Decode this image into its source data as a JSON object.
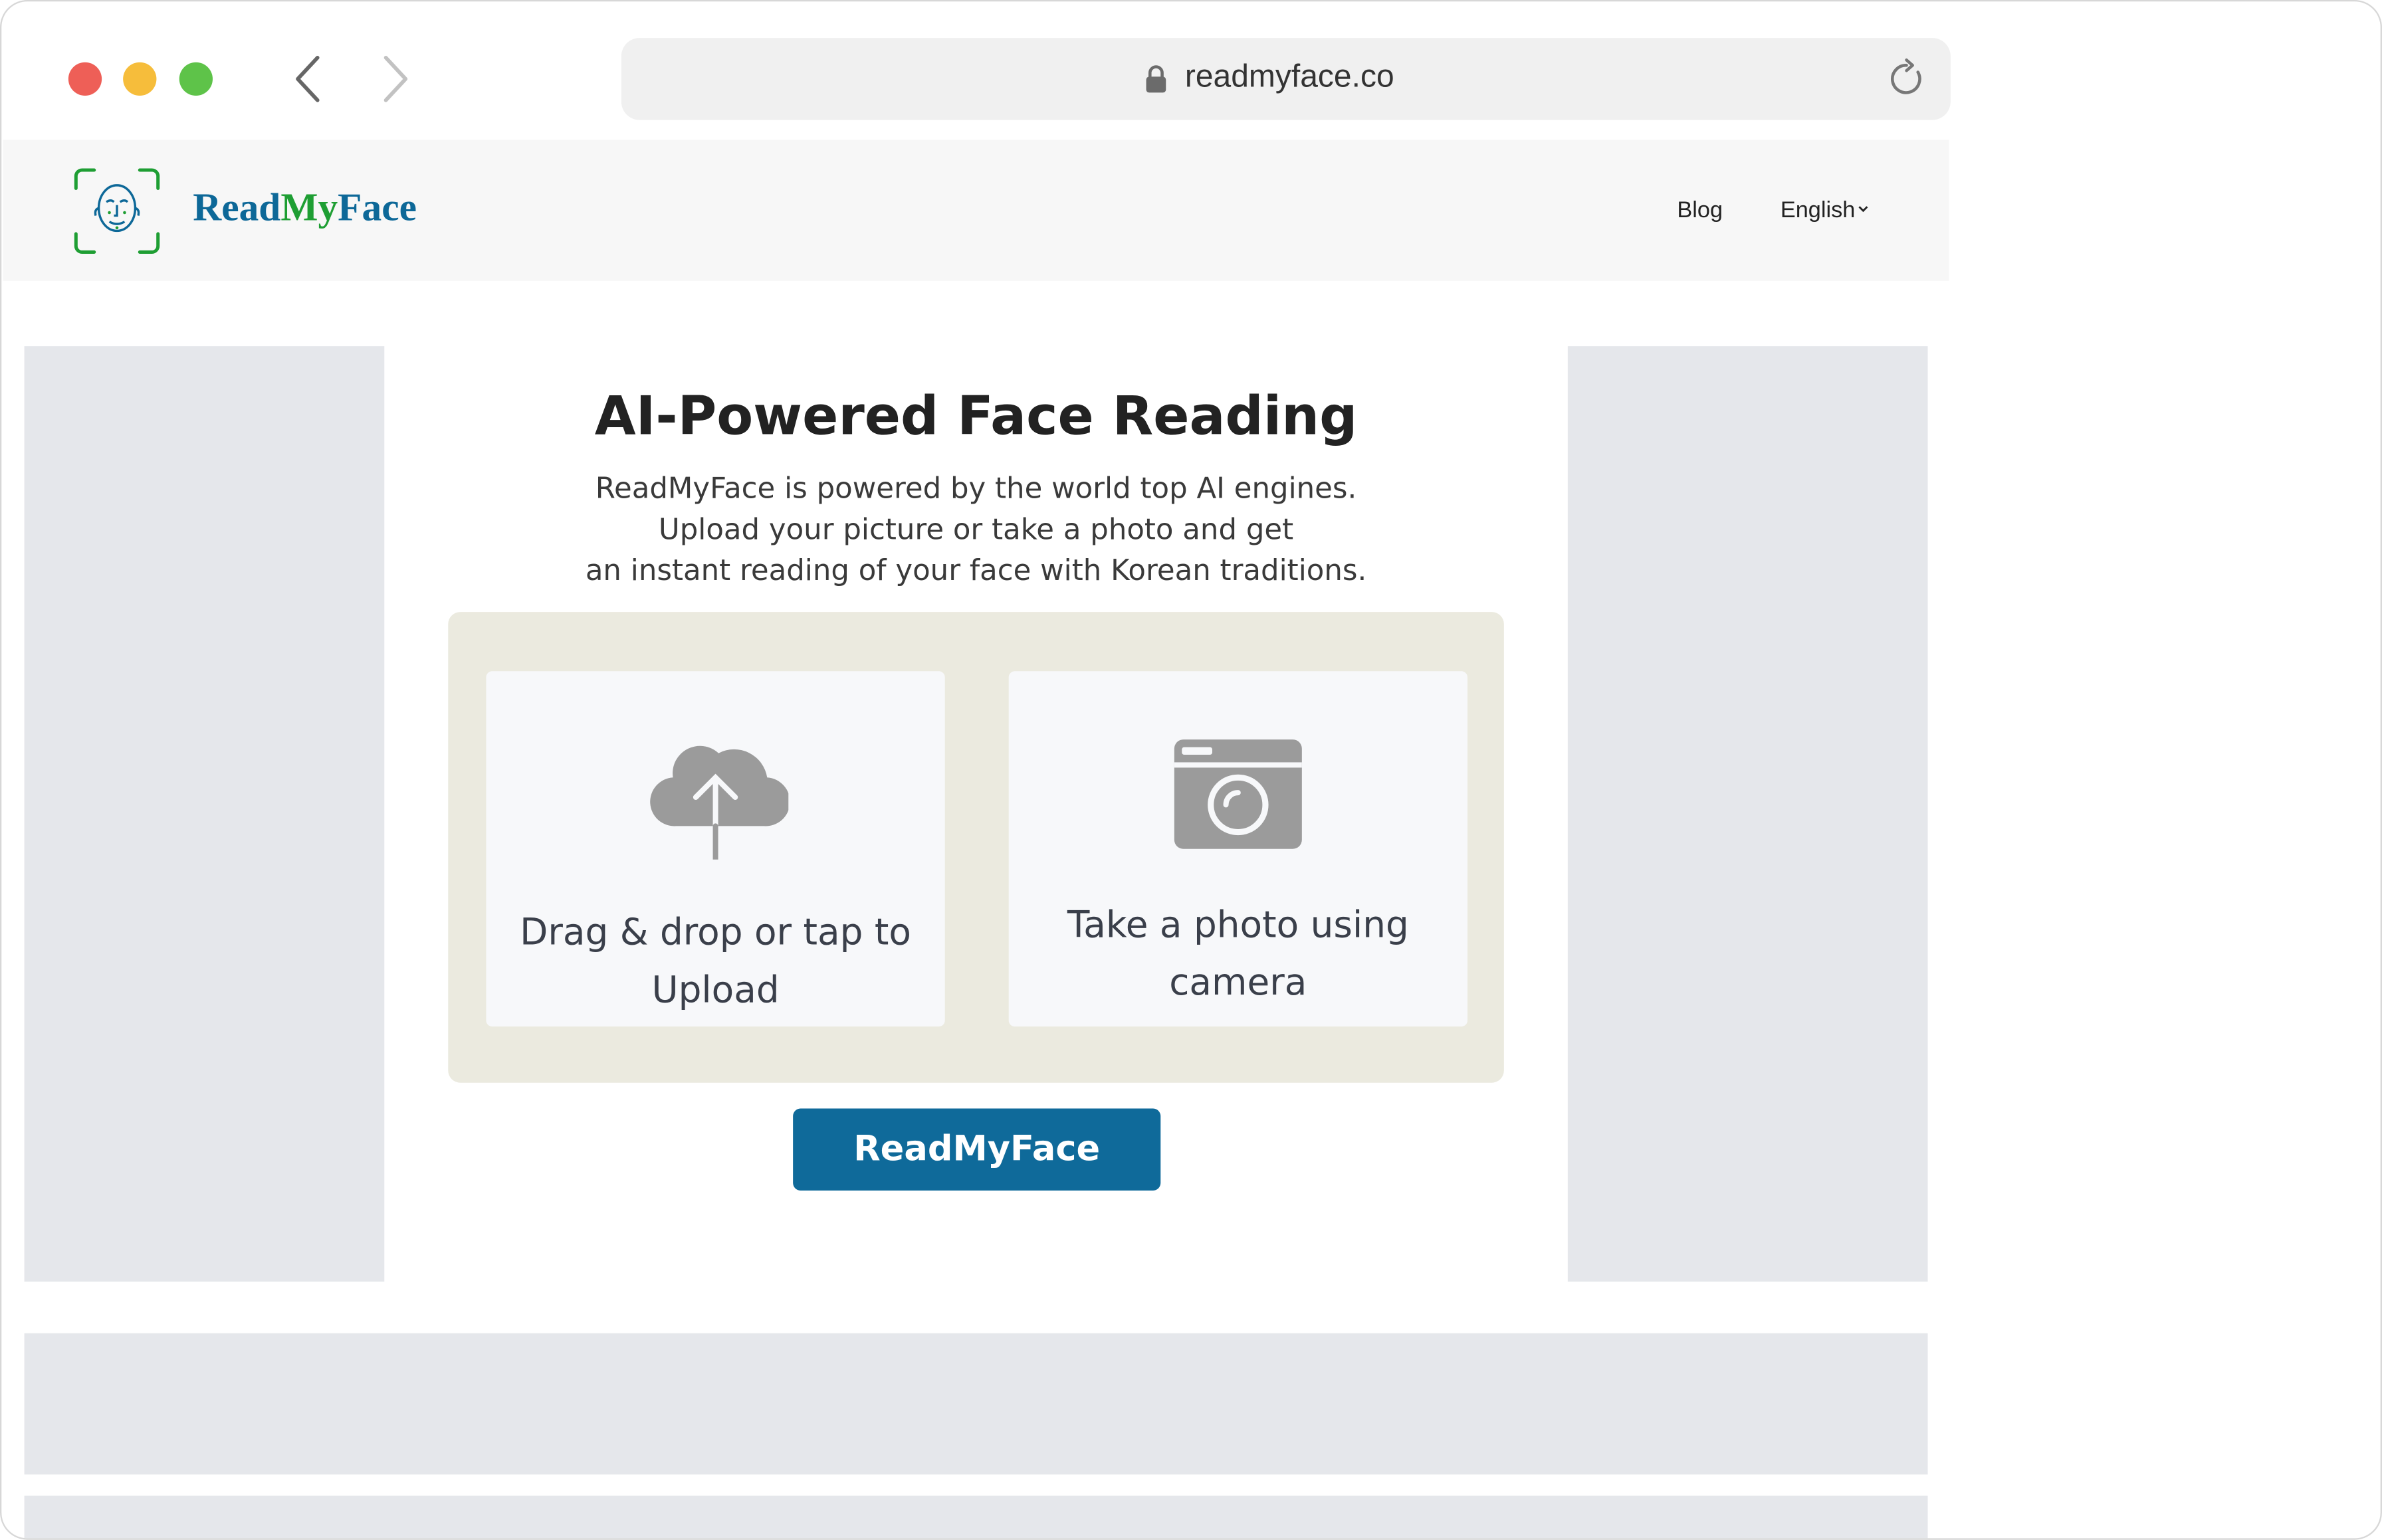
{
  "browser": {
    "url": "readmyface.co"
  },
  "header": {
    "brand_part1": "Read",
    "brand_part2": "My",
    "brand_part3": "Face",
    "nav_blog": "Blog",
    "nav_language": "English"
  },
  "hero": {
    "title": "AI-Powered Face Reading",
    "subtitle_line1": "ReadMyFace is powered by the world top AI engines.",
    "subtitle_line2": "Upload your picture or take a photo and get",
    "subtitle_line3": "an instant reading of your face with Korean traditions."
  },
  "upload": {
    "upload_line1": "Drag & drop or tap to",
    "upload_line2": "Upload",
    "camera_line1": "Take a photo using",
    "camera_line2": "camera"
  },
  "cta": {
    "label": "ReadMyFace"
  },
  "colors": {
    "brand_blue": "#0d6898",
    "brand_green": "#1e9e33",
    "cta_background": "#0f6a9a",
    "upload_panel": "#ebeadf",
    "ad_placeholder": "#e5e7eb"
  },
  "icons": [
    "lock-icon",
    "reload-icon",
    "back-arrow-icon",
    "forward-arrow-icon",
    "face-scan-logo-icon",
    "cloud-upload-icon",
    "camera-icon",
    "chevron-down-icon"
  ]
}
